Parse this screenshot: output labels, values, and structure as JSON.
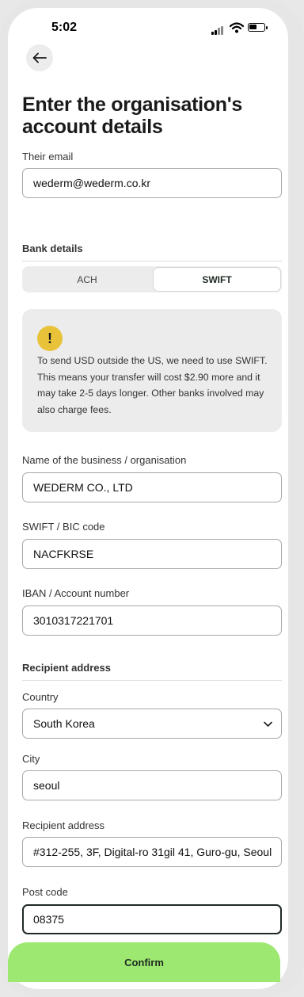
{
  "status_bar": {
    "time": "5:02"
  },
  "header": {
    "title": "Enter the organisation's account details"
  },
  "email": {
    "label": "Their email",
    "value": "wederm@wederm.co.kr"
  },
  "bank": {
    "section_title": "Bank details",
    "tabs": [
      "ACH",
      "SWIFT"
    ],
    "selected_tab": "SWIFT"
  },
  "notice": {
    "icon": "exclamation-icon",
    "text": "To send USD outside the US, we need to use SWIFT. This means your transfer will cost $2.90 more and it may take 2-5 days longer. Other banks involved may also charge fees."
  },
  "fields": {
    "business": {
      "label": "Name of the business / organisation",
      "value": "WEDERM CO., LTD"
    },
    "swift": {
      "label": "SWIFT / BIC code",
      "value": "NACFKRSE"
    },
    "iban": {
      "label": "IBAN / Account number",
      "value": "3010317221701"
    }
  },
  "address": {
    "section_title": "Recipient address",
    "country": {
      "label": "Country",
      "value": "South Korea"
    },
    "city": {
      "label": "City",
      "value": "seoul"
    },
    "street": {
      "label": "Recipient address",
      "value": "#312-255, 3F, Digital-ro 31gil 41, Guro-gu, Seoul"
    },
    "postcode": {
      "label": "Post code",
      "value": "08375"
    }
  },
  "actions": {
    "confirm": "Confirm"
  },
  "colors": {
    "accent": "#9de870",
    "warning": "#e8c33a",
    "text_dark": "#1f2a22"
  }
}
